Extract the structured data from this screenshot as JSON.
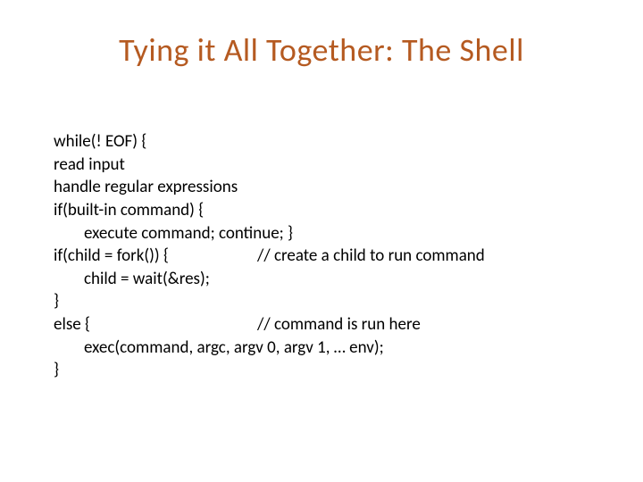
{
  "title": "Tying it All Together: The Shell",
  "code": {
    "l1": "while(! EOF) {",
    "l2": "read input",
    "l3": "handle regular expressions",
    "l4": "if(built-in command) {",
    "l5": "execute command; continue; }",
    "l6a": "if(child = fork()) {",
    "l6b": "// create a child to run command",
    "l7": "child = wait(&res);",
    "l8": "}",
    "l9a": "else {",
    "l9b": "// command is run here",
    "l10": "exec(command, argc, argv 0, argv 1, … env);",
    "l11": "}"
  }
}
